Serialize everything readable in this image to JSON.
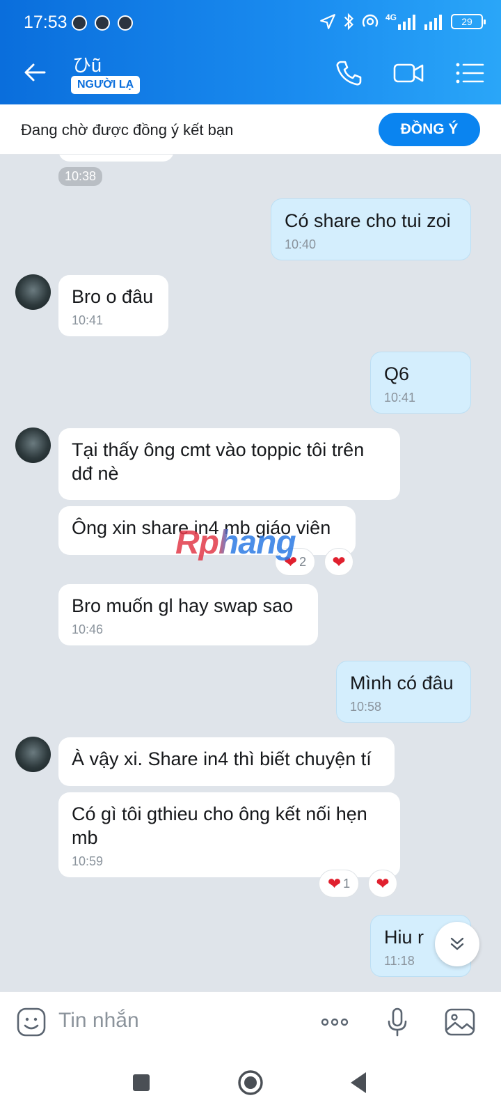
{
  "status_bar": {
    "time": "17:53",
    "network": "4G",
    "battery": "29"
  },
  "header": {
    "contact_name": "ひũ",
    "stranger_label": "NGƯỜI LẠ",
    "icons": [
      "back-arrow-icon",
      "phone-icon",
      "video-call-icon",
      "menu-list-icon"
    ]
  },
  "friend_banner": {
    "text": "Đang chờ được đồng ý kết bạn",
    "accept_label": "ĐỒNG Ý"
  },
  "messages": {
    "top_time_chip": "10:38",
    "m1": {
      "text": "Có share cho tui zoi",
      "time": "10:40"
    },
    "m2": {
      "text": "Bro o đâu",
      "time": "10:41"
    },
    "m3": {
      "text": "Q6",
      "time": "10:41"
    },
    "m4": {
      "text": "Tại thấy ông cmt vào toppic tôi trên dđ nè"
    },
    "m5": {
      "text": "Ông xin share in4 mb giáo viên",
      "reaction_count": "2"
    },
    "m6": {
      "text": "Bro muốn gl hay swap sao",
      "time": "10:46"
    },
    "m7": {
      "text": "Mình có đâu",
      "time": "10:58"
    },
    "m8": {
      "text": "À vậy xi. Share in4 thì biết chuyện tí"
    },
    "m9": {
      "text": "Có gì tôi gthieu cho ông kết nối hẹn mb",
      "time": "10:59",
      "reaction_count": "1"
    },
    "m10": {
      "text": "Hiu r",
      "time": "11:18"
    }
  },
  "watermark": "Rphang",
  "input_bar": {
    "placeholder": "Tin nhắn"
  },
  "colors": {
    "header_blue": "#0a6edc",
    "accent_blue": "#0a84f0",
    "outgoing_bubble": "#d4eefd",
    "chat_background": "#dfe4ea",
    "heart_red": "#e0202e"
  }
}
